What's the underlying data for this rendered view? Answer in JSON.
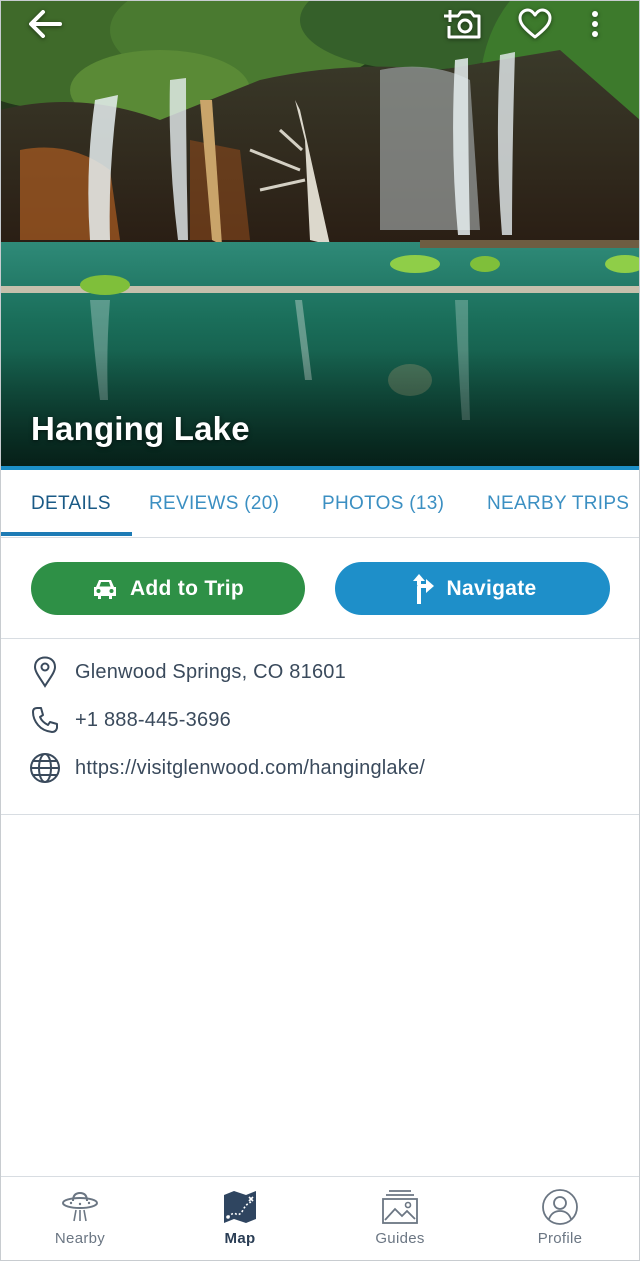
{
  "place": {
    "title": "Hanging Lake"
  },
  "topbar": {
    "back_icon": "back-arrow-icon",
    "add_photo_icon": "camera-plus-icon",
    "favorite_icon": "heart-icon",
    "more_icon": "more-vertical-icon"
  },
  "tabs": [
    {
      "label": "DETAILS",
      "active": true
    },
    {
      "label": "REVIEWS (20)",
      "active": false
    },
    {
      "label": "PHOTOS (13)",
      "active": false
    },
    {
      "label": "NEARBY TRIPS",
      "active": false
    }
  ],
  "actions": {
    "add_to_trip": {
      "label": "Add to Trip",
      "icon": "car-icon",
      "color": "#2e9046"
    },
    "navigate": {
      "label": "Navigate",
      "icon": "turn-arrow-icon",
      "color": "#1e8fc9"
    }
  },
  "info": {
    "address": {
      "text": "Glenwood Springs, CO 81601",
      "icon": "location-pin-icon"
    },
    "phone": {
      "text": "+1 888-445-3696",
      "icon": "phone-icon"
    },
    "website": {
      "text": "https://visitglenwood.com/hanginglake/",
      "icon": "globe-icon"
    }
  },
  "bottom_nav": [
    {
      "label": "Nearby",
      "icon": "ufo-icon",
      "active": false
    },
    {
      "label": "Map",
      "icon": "map-icon",
      "active": true
    },
    {
      "label": "Guides",
      "icon": "guide-photo-icon",
      "active": false
    },
    {
      "label": "Profile",
      "icon": "profile-icon",
      "active": false
    }
  ],
  "colors": {
    "accent": "#1c8fc7",
    "active_tab": "#1a5a86",
    "tab": "#3b8fc2"
  }
}
